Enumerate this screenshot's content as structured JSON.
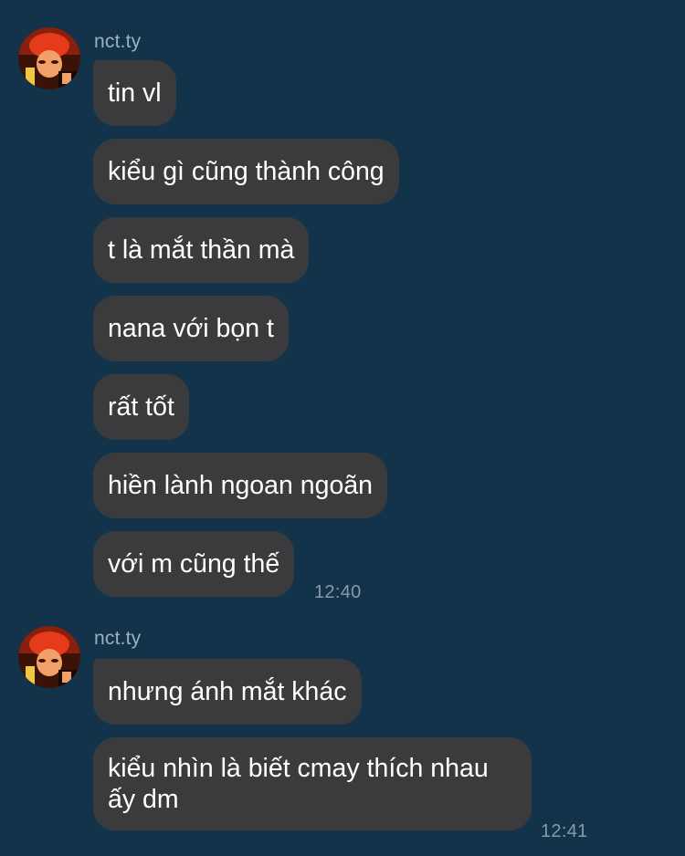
{
  "groups": [
    {
      "sender": "nct.ty",
      "messages": [
        "tin vl",
        "kiểu gì cũng thành công",
        "t là mắt thần mà",
        "nana với bọn t",
        "rất tốt",
        "hiền lành ngoan ngoãn",
        "với m cũng thế"
      ],
      "time": "12:40"
    },
    {
      "sender": "nct.ty",
      "messages": [
        "nhưng ánh mắt khác",
        "kiểu nhìn là biết cmay thích nhau ấy dm"
      ],
      "time": "12:41"
    }
  ],
  "colors": {
    "background": "#13334a",
    "bubble": "#3b3b3e",
    "text": "#ffffff",
    "meta": "#9fb0bd"
  },
  "icons": {
    "avatar": "avatar-photo"
  }
}
